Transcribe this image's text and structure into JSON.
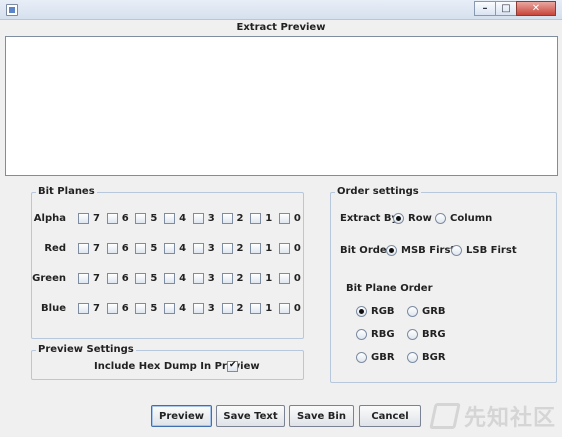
{
  "window": {
    "minimize": "–",
    "maximize": "□",
    "close": "✕"
  },
  "preview": {
    "title": "Extract Preview"
  },
  "bit_planes": {
    "title": "Bit Planes",
    "bits": [
      "7",
      "6",
      "5",
      "4",
      "3",
      "2",
      "1",
      "0"
    ],
    "rows": [
      {
        "label": "Alpha"
      },
      {
        "label": "Red"
      },
      {
        "label": "Green"
      },
      {
        "label": "Blue"
      }
    ]
  },
  "order_settings": {
    "title": "Order settings",
    "extract_by_label": "Extract By",
    "extract_by_options": [
      "Row",
      "Column"
    ],
    "extract_by_selected": "Row",
    "bit_order_label": "Bit Order",
    "bit_order_options": [
      "MSB First",
      "LSB First"
    ],
    "bit_order_selected": "MSB First",
    "bit_plane_order_title": "Bit Plane Order",
    "bit_plane_order_options": [
      "RGB",
      "GRB",
      "RBG",
      "BRG",
      "GBR",
      "BGR"
    ],
    "bit_plane_order_selected": "RGB"
  },
  "preview_settings": {
    "title": "Preview Settings",
    "hex_dump_label": "Include Hex Dump In Preview",
    "hex_dump_checked": true
  },
  "buttons": {
    "preview": "Preview",
    "save_text": "Save Text",
    "save_bin": "Save Bin",
    "cancel": "Cancel"
  },
  "watermark": {
    "text": "先知社区"
  }
}
